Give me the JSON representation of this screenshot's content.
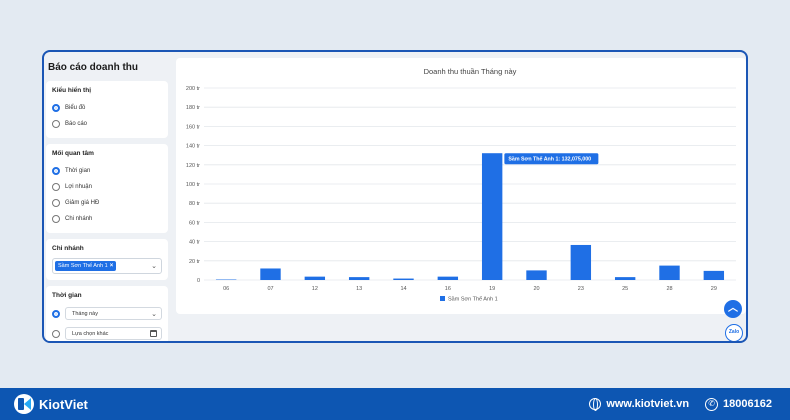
{
  "page": {
    "title": "Báo cáo doanh thu"
  },
  "display_type": {
    "title": "Kiểu hiển thị",
    "options": [
      {
        "label": "Biểu đồ",
        "selected": true
      },
      {
        "label": "Báo cáo",
        "selected": false
      }
    ]
  },
  "concern": {
    "title": "Mối quan tâm",
    "options": [
      {
        "label": "Thời gian",
        "selected": true
      },
      {
        "label": "Lợi nhuận",
        "selected": false
      },
      {
        "label": "Giảm giá HĐ",
        "selected": false
      },
      {
        "label": "Chi nhánh",
        "selected": false
      }
    ]
  },
  "branch": {
    "title": "Chi nhánh",
    "selected_chip": "Sầm Sơn Thế Anh 1"
  },
  "time": {
    "title": "Thời gian",
    "preset_value": "Tháng này",
    "custom_label": "Lựa chọn khác"
  },
  "chart_data": {
    "type": "bar",
    "title": "Doanh thu thuần Tháng này",
    "categories": [
      "06",
      "07",
      "12",
      "13",
      "14",
      "16",
      "19",
      "20",
      "23",
      "25",
      "28",
      "29"
    ],
    "series": [
      {
        "name": "Sầm Sơn Thế Anh 1",
        "values": [
          0.5,
          12,
          3.5,
          3,
          1.5,
          3.5,
          132.075,
          10,
          36.5,
          3,
          15,
          9.5
        ]
      }
    ],
    "yticks": [
      "0",
      "20 tr",
      "40 tr",
      "60 tr",
      "80 tr",
      "100 tr",
      "120 tr",
      "140 tr",
      "160 tr",
      "180 tr",
      "200 tr"
    ],
    "ylim": [
      0,
      200
    ],
    "grid": true,
    "legend": "bottom",
    "tooltip": "Sầm Sơn Thế Anh 1: 132,075,000",
    "bar_color": "#1f6fe5"
  },
  "footer": {
    "brand": "KiotViet",
    "website": "www.kiotviet.vn",
    "phone": "18006162"
  },
  "widgets": {
    "scroll_top_icon": "chevron-up-icon",
    "zalo_label": "Zalo"
  },
  "colors": {
    "accent": "#1f6fe5",
    "footer_bg": "#0d56b2",
    "frame": "#1b56b5"
  }
}
